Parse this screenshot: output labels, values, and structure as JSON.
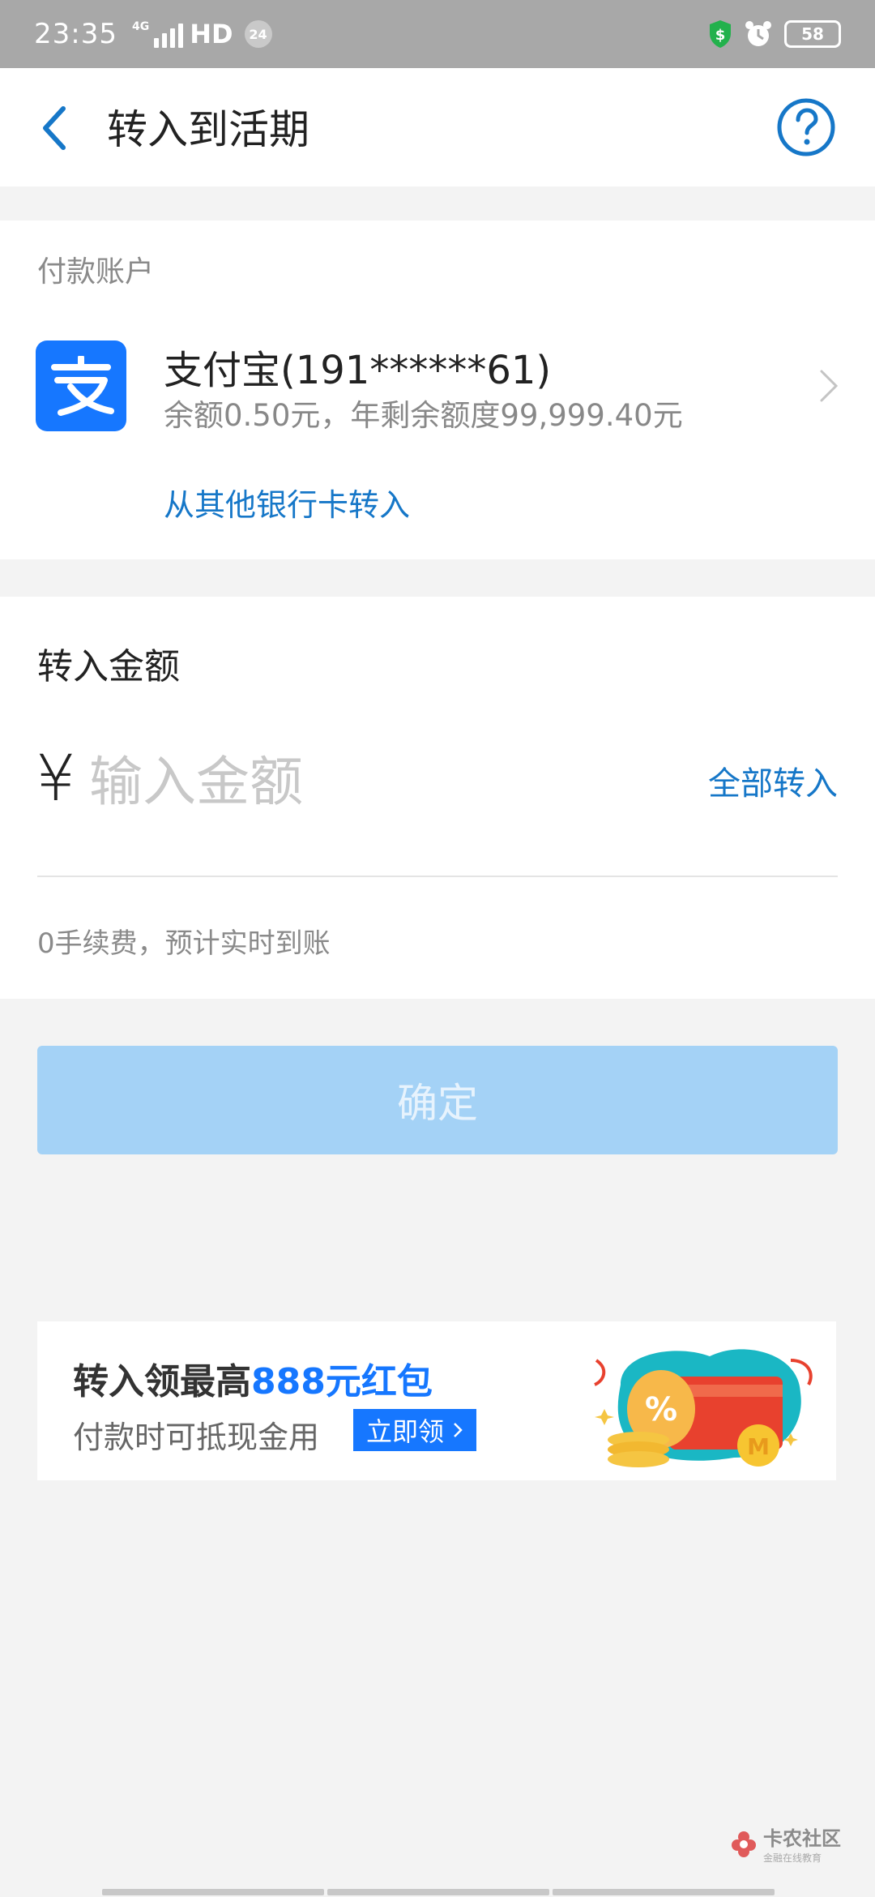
{
  "status_bar": {
    "time": "23:35",
    "network": "4G",
    "hd": "HD",
    "notification_count": "24",
    "battery": "58"
  },
  "nav": {
    "title": "转入到活期",
    "back_icon": "chevron-left-icon",
    "help_icon": "question-circle-icon"
  },
  "account": {
    "section_label": "付款账户",
    "name": "支付宝(191******61)",
    "balance": "余额0.50元，年剩余额度99,999.40元",
    "logo_char": "支",
    "other_bank_link": "从其他银行卡转入"
  },
  "amount": {
    "label": "转入金额",
    "currency_symbol": "¥",
    "placeholder": "输入金额",
    "value": "",
    "all_in_link": "全部转入",
    "fee_note": "0手续费，预计实时到账"
  },
  "confirm": {
    "label": "确定"
  },
  "promo": {
    "title_prefix": "转入领最高",
    "title_highlight": "888元红包",
    "subtitle": "付款时可抵现金用",
    "button_label": "立即领"
  },
  "watermark": {
    "main": "卡农社区",
    "sub": "金融在线教育"
  },
  "colors": {
    "accent": "#1677ff",
    "link": "#1677c8",
    "confirm_disabled": "#a4d2f6",
    "status_bar": "#a8a8a8",
    "background": "#f3f3f3"
  }
}
